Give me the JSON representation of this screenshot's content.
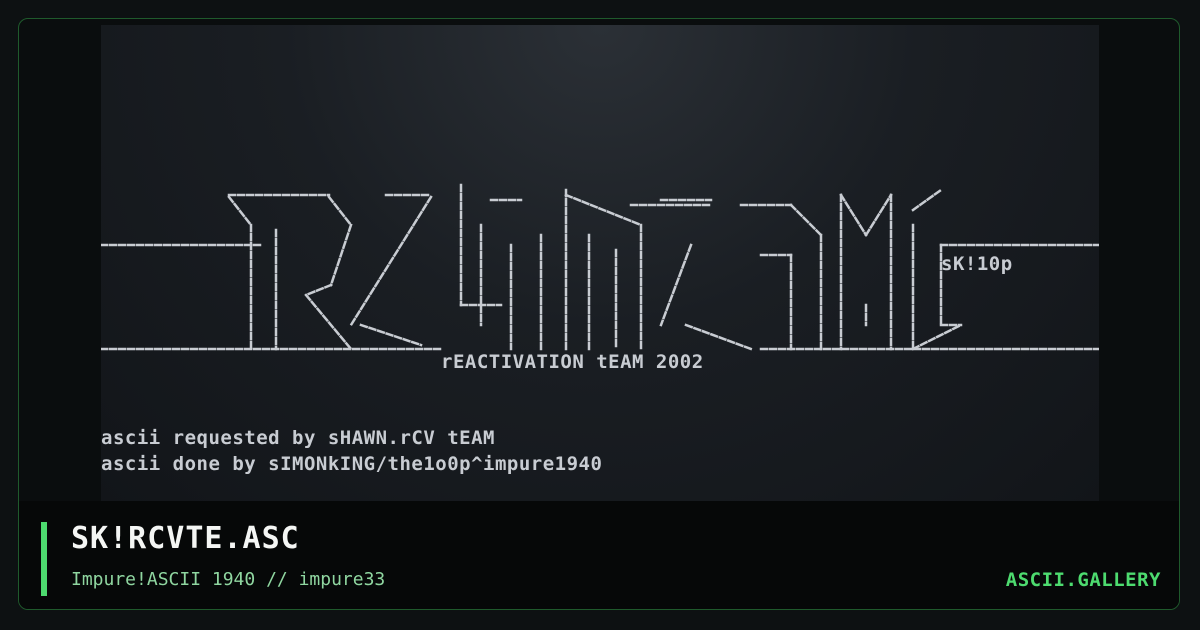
{
  "artwork": {
    "tagline": "rEACTIVATION tEAM 2002",
    "author_tag": "sK!10p",
    "credit_lines": [
      "ascii requested by sHAWN.rCV tEAM",
      "ascii done by sIMONkING/the1o0p^impure1940"
    ],
    "colors": {
      "text": "#c8ccd2",
      "background": "#1a1e23"
    }
  },
  "footer": {
    "title": "SK!RCVTE.ASC",
    "subtitle": "Impure!ASCII 1940 // impure33",
    "site": "ASCII.GALLERY",
    "accent_color": "#4ddb6f"
  }
}
